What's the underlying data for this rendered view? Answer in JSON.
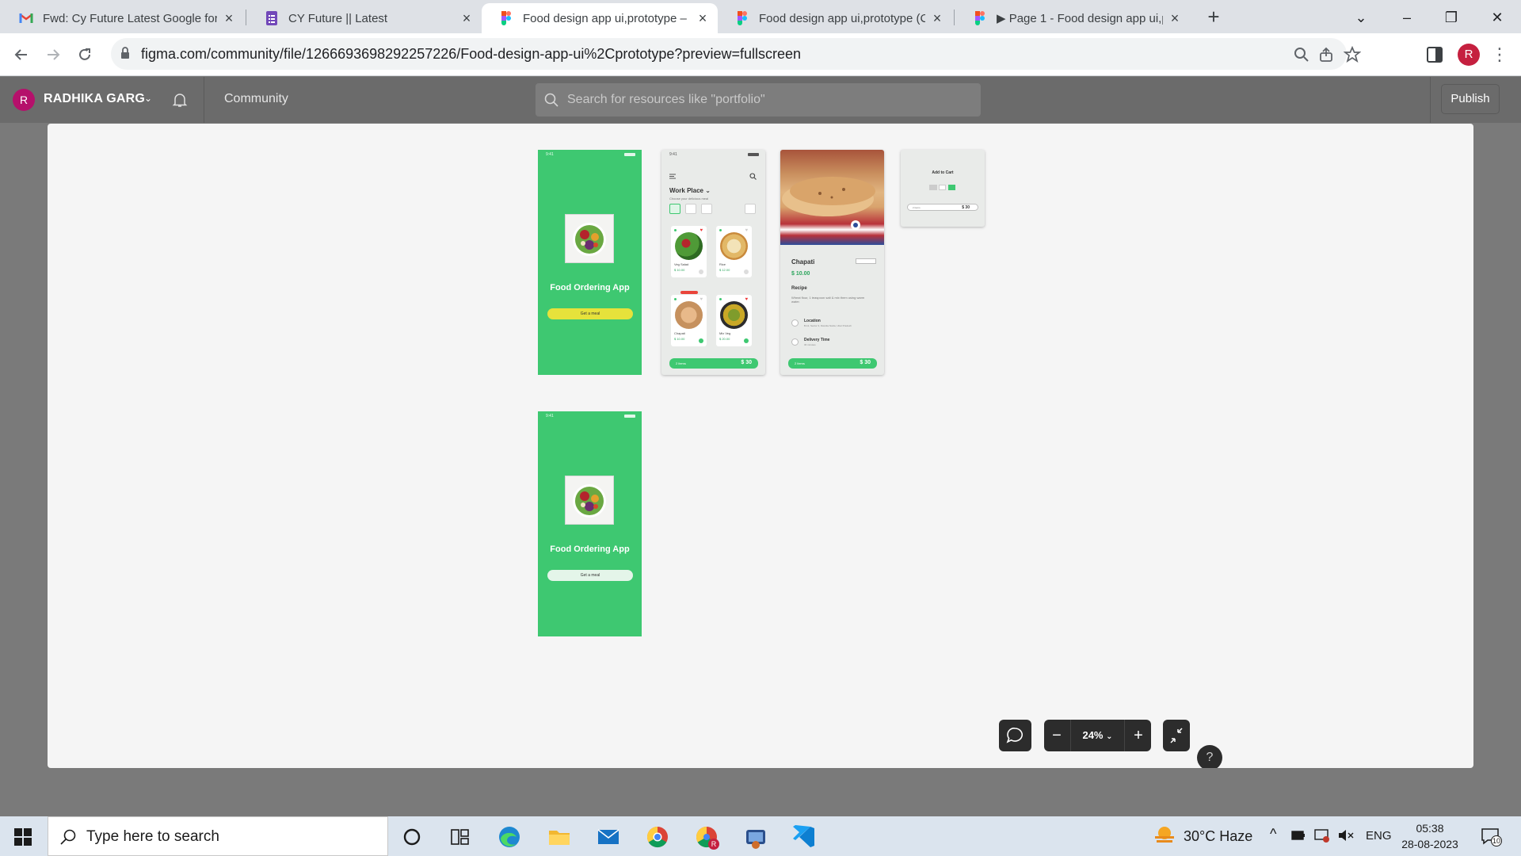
{
  "browser": {
    "tabs": [
      {
        "title": "Fwd: Cy Future Latest Google for",
        "icon": "gmail-icon",
        "active": false
      },
      {
        "title": "CY Future || Latest",
        "icon": "google-forms-icon",
        "active": false
      },
      {
        "title": "Food design app ui,prototype – F",
        "icon": "figma-icon",
        "active": true
      },
      {
        "title": "Food design app ui,prototype (C",
        "icon": "figma-icon",
        "active": false
      },
      {
        "title": "▶ Page 1 - Food design app ui,p",
        "icon": "figma-icon",
        "active": false
      }
    ],
    "url": "figma.com/community/file/1266693698292257226/Food-design-app-ui%2Cprototype?preview=fullscreen",
    "profile_initial": "R"
  },
  "figma": {
    "user_initial": "R",
    "user_name": "RADHIKA GARG",
    "community": "Community",
    "search_placeholder": "Search for resources like \"portfolio\"",
    "publish": "Publish",
    "zoom": "24%"
  },
  "frames": {
    "splash1": {
      "title": "Food Ordering App",
      "button": "Get a meal",
      "status_time": "9:41"
    },
    "splash2": {
      "title": "Food Ordering App",
      "button": "Get a meal",
      "status_time": "9:41"
    },
    "home": {
      "status_time": "9:41",
      "title": "Work Place ⌄",
      "subtitle": "Choose your delicious meal",
      "cards": [
        {
          "name": "Veg Salad",
          "price": "$ 10.00"
        },
        {
          "name": "Rice",
          "price": "$ 12.00"
        },
        {
          "name": "Chapati",
          "price": "$ 10.00"
        },
        {
          "name": "Mix Veg",
          "price": "$ 20.00"
        }
      ],
      "bar_left": "2 items",
      "bar_right": "$ 30"
    },
    "detail": {
      "title": "Chapati",
      "price": "$ 10.00",
      "recipe_heading": "Recipe",
      "recipe_text": "Wheat flour, 1 teaspoon salt & mix them using warm water.",
      "location_label": "Location",
      "location_text": "B-12, Sector 3, Dwarka Noida, Uttar Pradesh",
      "delivery_label": "Delivery Time",
      "delivery_text": "30 minutes",
      "bar_left": "2 items",
      "bar_right": "$ 30"
    },
    "cart": {
      "title": "Add to Cart",
      "bar_left": "2 items",
      "bar_right": "$ 30"
    }
  },
  "taskbar": {
    "search_placeholder": "Type here to search",
    "weather": "30°C  Haze",
    "language": "ENG",
    "time": "05:38",
    "date": "28-08-2023",
    "notifications": "10"
  },
  "colors": {
    "figma_green": "#3ec871",
    "meal_button_yellow": "#e6e23b",
    "chrome_profile": "#c5203f"
  }
}
